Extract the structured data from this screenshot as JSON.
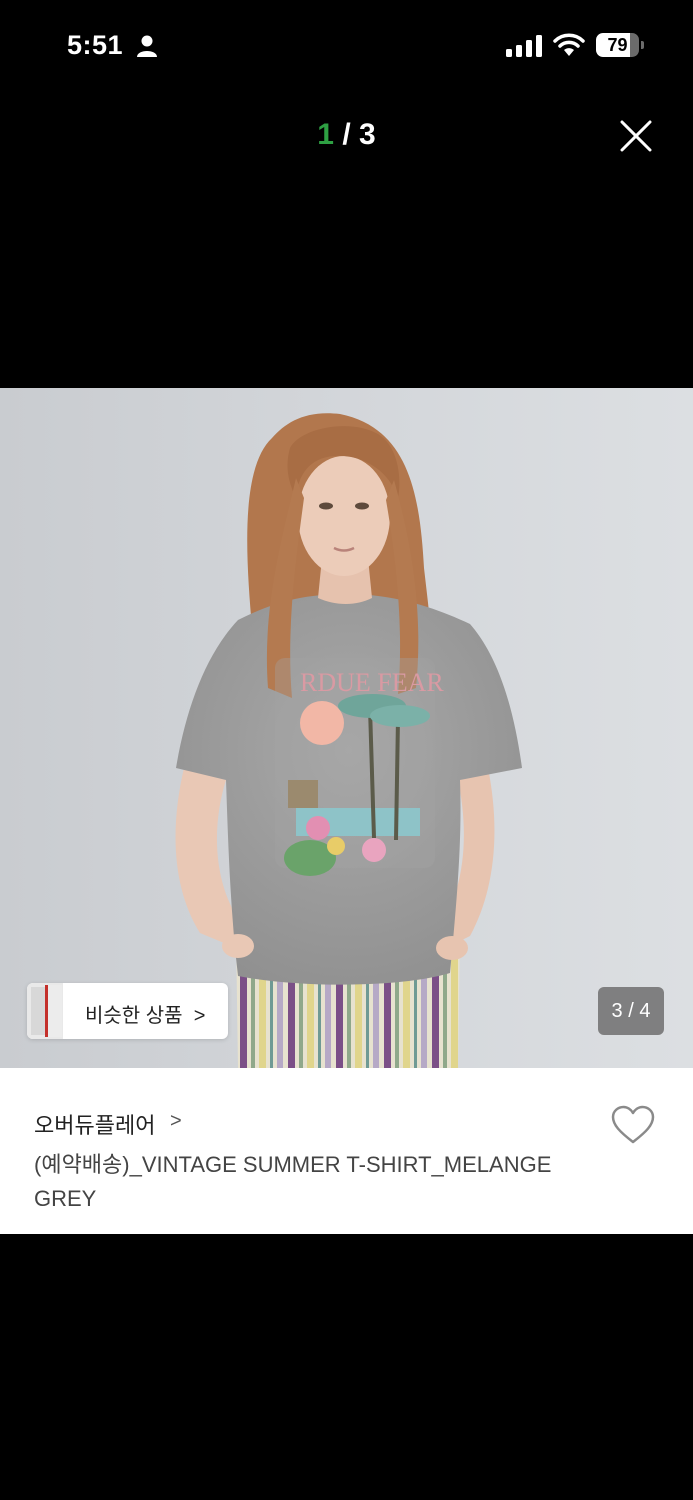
{
  "status_bar": {
    "time": "5:51",
    "battery_percent": 79,
    "battery_label": "79",
    "icons": [
      "person-icon",
      "signal-icon",
      "wifi-icon",
      "battery-icon"
    ]
  },
  "viewer": {
    "counter_current": "1",
    "counter_separator": " / ",
    "counter_total": "3",
    "close_icon": "close-icon"
  },
  "product": {
    "image_alt": "",
    "similar_button_label": "비슷한 상품",
    "similar_chevron": ">",
    "page_indicator": "3 / 4",
    "brand": "오버듀플레어",
    "brand_chevron": ">",
    "name_line1": "(예약배송)_VINTAGE SUMMER T-SHIRT_MELANGE",
    "name_line2": "GREY",
    "wishlist_icon": "heart-icon"
  },
  "colors": {
    "background": "#000000",
    "counter_accent": "#2ea043",
    "panel": "#ffffff"
  }
}
